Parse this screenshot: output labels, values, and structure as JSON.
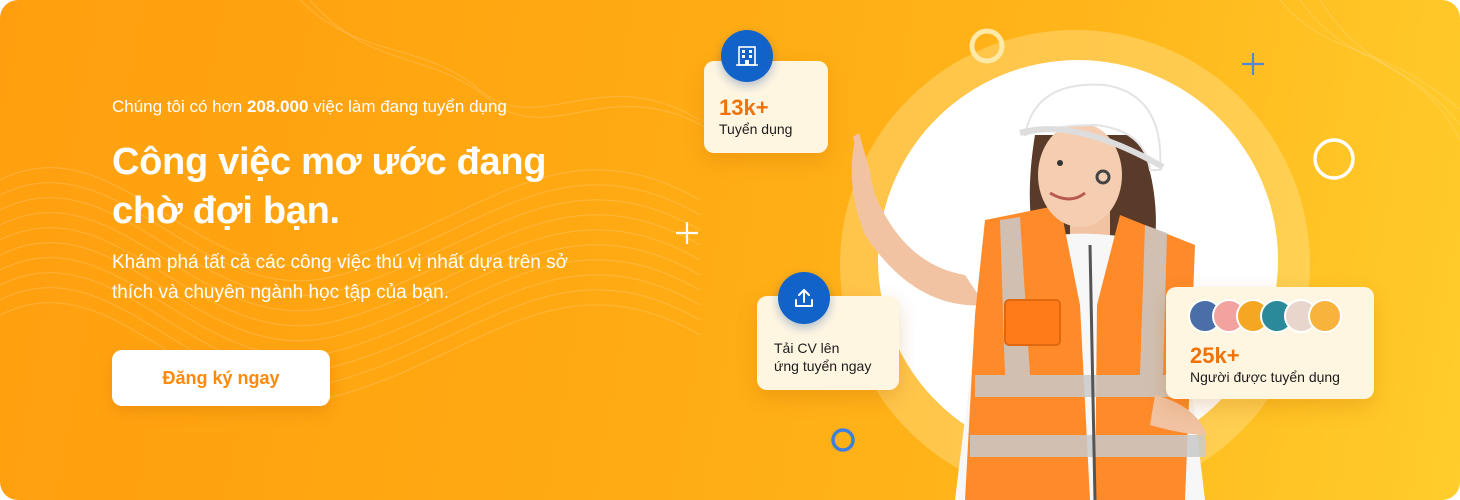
{
  "hero": {
    "subtitle_prefix": "Chúng tôi có hơn ",
    "subtitle_count": "208.000",
    "subtitle_suffix": " việc làm đang tuyển dụng",
    "headline": "Công việc mơ ước đang chờ đợi bạn.",
    "description": "Khám phá tất cả các công việc thú vị nhất dựa trên sở thích và chuyên ngành học tập của bạn.",
    "cta_label": "Đăng ký ngay"
  },
  "cards": {
    "recruiting": {
      "value": "13k+",
      "label": "Tuyển dụng",
      "icon": "building-icon"
    },
    "upload_cv": {
      "line1": "Tải CV lên",
      "line2": "ứng tuyển ngay",
      "icon": "upload-icon"
    },
    "hired": {
      "value": "25k+",
      "label": "Người được tuyển dụng",
      "avatar_count": 6
    }
  },
  "colors": {
    "background_start": "#ff9f0f",
    "background_end": "#ffcd2c",
    "accent_orange": "#f0730a",
    "icon_blue": "#1263c9",
    "card_bg": "#fff6e2"
  }
}
